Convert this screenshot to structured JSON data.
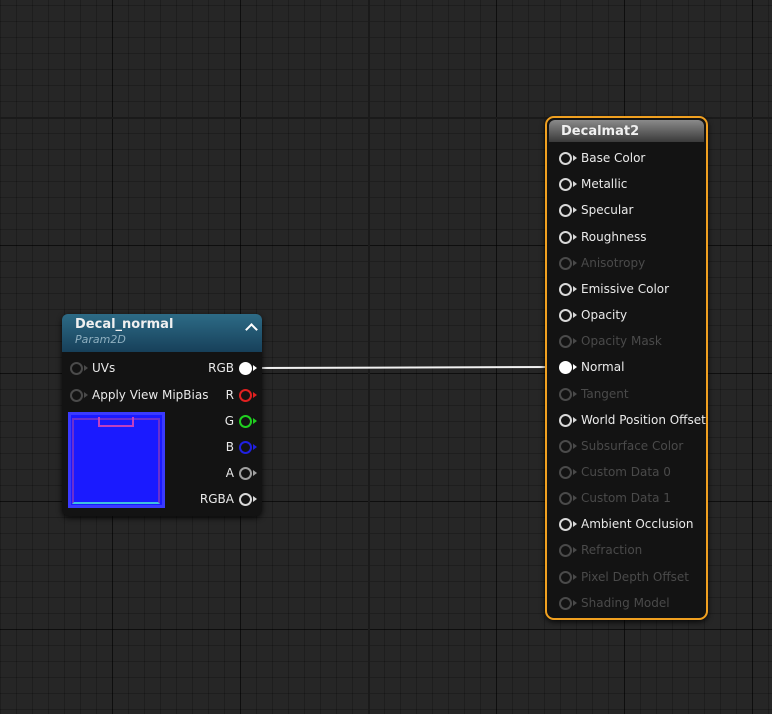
{
  "texture_node": {
    "title": "Decal_normal",
    "subtitle": "Param2D",
    "collapse_glyph": "⌃",
    "inputs": [
      "UVs",
      "Apply View MipBias"
    ],
    "outputs": [
      "RGB",
      "R",
      "G",
      "B",
      "A",
      "RGBA"
    ],
    "thumbnail_color": "#1a1aff"
  },
  "material_node": {
    "title": "Decalmat2",
    "accent": "#f0a020",
    "pins": [
      {
        "label": "Base Color",
        "enabled": true
      },
      {
        "label": "Metallic",
        "enabled": true
      },
      {
        "label": "Specular",
        "enabled": true
      },
      {
        "label": "Roughness",
        "enabled": true
      },
      {
        "label": "Anisotropy",
        "enabled": false
      },
      {
        "label": "Emissive Color",
        "enabled": true
      },
      {
        "label": "Opacity",
        "enabled": true
      },
      {
        "label": "Opacity Mask",
        "enabled": false
      },
      {
        "label": "Normal",
        "enabled": true,
        "connected": true
      },
      {
        "label": "Tangent",
        "enabled": false
      },
      {
        "label": "World Position Offset",
        "enabled": true
      },
      {
        "label": "Subsurface Color",
        "enabled": false
      },
      {
        "label": "Custom Data 0",
        "enabled": false
      },
      {
        "label": "Custom Data 1",
        "enabled": false
      },
      {
        "label": "Ambient Occlusion",
        "enabled": true
      },
      {
        "label": "Refraction",
        "enabled": false
      },
      {
        "label": "Pixel Depth Offset",
        "enabled": false
      },
      {
        "label": "Shading Model",
        "enabled": false
      }
    ]
  }
}
